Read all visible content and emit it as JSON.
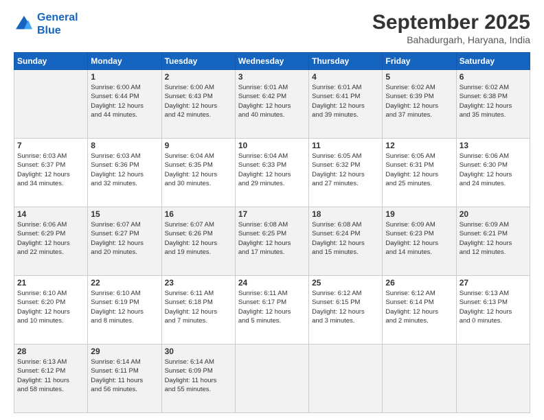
{
  "header": {
    "logo_line1": "General",
    "logo_line2": "Blue",
    "title": "September 2025",
    "location": "Bahadurgarh, Haryana, India"
  },
  "days_of_week": [
    "Sunday",
    "Monday",
    "Tuesday",
    "Wednesday",
    "Thursday",
    "Friday",
    "Saturday"
  ],
  "weeks": [
    [
      {
        "num": "",
        "info": ""
      },
      {
        "num": "1",
        "info": "Sunrise: 6:00 AM\nSunset: 6:44 PM\nDaylight: 12 hours\nand 44 minutes."
      },
      {
        "num": "2",
        "info": "Sunrise: 6:00 AM\nSunset: 6:43 PM\nDaylight: 12 hours\nand 42 minutes."
      },
      {
        "num": "3",
        "info": "Sunrise: 6:01 AM\nSunset: 6:42 PM\nDaylight: 12 hours\nand 40 minutes."
      },
      {
        "num": "4",
        "info": "Sunrise: 6:01 AM\nSunset: 6:41 PM\nDaylight: 12 hours\nand 39 minutes."
      },
      {
        "num": "5",
        "info": "Sunrise: 6:02 AM\nSunset: 6:39 PM\nDaylight: 12 hours\nand 37 minutes."
      },
      {
        "num": "6",
        "info": "Sunrise: 6:02 AM\nSunset: 6:38 PM\nDaylight: 12 hours\nand 35 minutes."
      }
    ],
    [
      {
        "num": "7",
        "info": "Sunrise: 6:03 AM\nSunset: 6:37 PM\nDaylight: 12 hours\nand 34 minutes."
      },
      {
        "num": "8",
        "info": "Sunrise: 6:03 AM\nSunset: 6:36 PM\nDaylight: 12 hours\nand 32 minutes."
      },
      {
        "num": "9",
        "info": "Sunrise: 6:04 AM\nSunset: 6:35 PM\nDaylight: 12 hours\nand 30 minutes."
      },
      {
        "num": "10",
        "info": "Sunrise: 6:04 AM\nSunset: 6:33 PM\nDaylight: 12 hours\nand 29 minutes."
      },
      {
        "num": "11",
        "info": "Sunrise: 6:05 AM\nSunset: 6:32 PM\nDaylight: 12 hours\nand 27 minutes."
      },
      {
        "num": "12",
        "info": "Sunrise: 6:05 AM\nSunset: 6:31 PM\nDaylight: 12 hours\nand 25 minutes."
      },
      {
        "num": "13",
        "info": "Sunrise: 6:06 AM\nSunset: 6:30 PM\nDaylight: 12 hours\nand 24 minutes."
      }
    ],
    [
      {
        "num": "14",
        "info": "Sunrise: 6:06 AM\nSunset: 6:29 PM\nDaylight: 12 hours\nand 22 minutes."
      },
      {
        "num": "15",
        "info": "Sunrise: 6:07 AM\nSunset: 6:27 PM\nDaylight: 12 hours\nand 20 minutes."
      },
      {
        "num": "16",
        "info": "Sunrise: 6:07 AM\nSunset: 6:26 PM\nDaylight: 12 hours\nand 19 minutes."
      },
      {
        "num": "17",
        "info": "Sunrise: 6:08 AM\nSunset: 6:25 PM\nDaylight: 12 hours\nand 17 minutes."
      },
      {
        "num": "18",
        "info": "Sunrise: 6:08 AM\nSunset: 6:24 PM\nDaylight: 12 hours\nand 15 minutes."
      },
      {
        "num": "19",
        "info": "Sunrise: 6:09 AM\nSunset: 6:23 PM\nDaylight: 12 hours\nand 14 minutes."
      },
      {
        "num": "20",
        "info": "Sunrise: 6:09 AM\nSunset: 6:21 PM\nDaylight: 12 hours\nand 12 minutes."
      }
    ],
    [
      {
        "num": "21",
        "info": "Sunrise: 6:10 AM\nSunset: 6:20 PM\nDaylight: 12 hours\nand 10 minutes."
      },
      {
        "num": "22",
        "info": "Sunrise: 6:10 AM\nSunset: 6:19 PM\nDaylight: 12 hours\nand 8 minutes."
      },
      {
        "num": "23",
        "info": "Sunrise: 6:11 AM\nSunset: 6:18 PM\nDaylight: 12 hours\nand 7 minutes."
      },
      {
        "num": "24",
        "info": "Sunrise: 6:11 AM\nSunset: 6:17 PM\nDaylight: 12 hours\nand 5 minutes."
      },
      {
        "num": "25",
        "info": "Sunrise: 6:12 AM\nSunset: 6:15 PM\nDaylight: 12 hours\nand 3 minutes."
      },
      {
        "num": "26",
        "info": "Sunrise: 6:12 AM\nSunset: 6:14 PM\nDaylight: 12 hours\nand 2 minutes."
      },
      {
        "num": "27",
        "info": "Sunrise: 6:13 AM\nSunset: 6:13 PM\nDaylight: 12 hours\nand 0 minutes."
      }
    ],
    [
      {
        "num": "28",
        "info": "Sunrise: 6:13 AM\nSunset: 6:12 PM\nDaylight: 11 hours\nand 58 minutes."
      },
      {
        "num": "29",
        "info": "Sunrise: 6:14 AM\nSunset: 6:11 PM\nDaylight: 11 hours\nand 56 minutes."
      },
      {
        "num": "30",
        "info": "Sunrise: 6:14 AM\nSunset: 6:09 PM\nDaylight: 11 hours\nand 55 minutes."
      },
      {
        "num": "",
        "info": ""
      },
      {
        "num": "",
        "info": ""
      },
      {
        "num": "",
        "info": ""
      },
      {
        "num": "",
        "info": ""
      }
    ]
  ]
}
